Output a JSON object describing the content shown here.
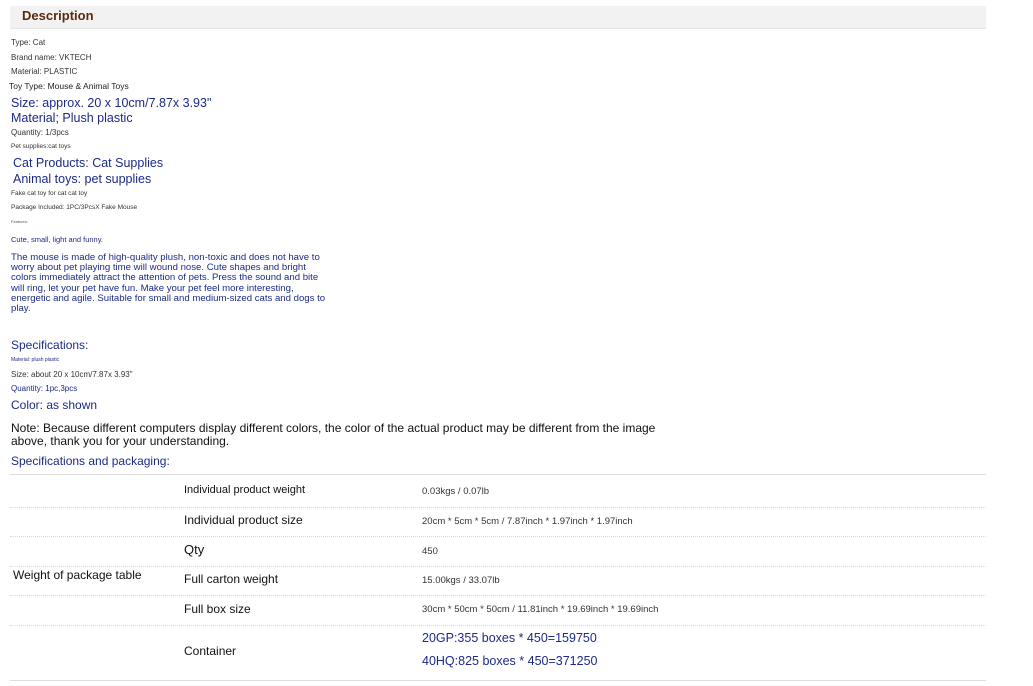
{
  "header": {
    "title": "Description"
  },
  "attributes": [
    "Type: Cat",
    "Brand name: VKTECH",
    "Material: PLASTIC",
    "Toy Type: Mouse & Animal Toys"
  ],
  "highlights": {
    "size": "Size: approx. 20 x 10cm/7.87x 3.93\"",
    "material": "Material; Plush plastic"
  },
  "quantity_line": "Quantity: 1/3pcs",
  "pet_supplies": "Pet supplies:cat toys",
  "cat_products": "Cat Products: Cat Supplies",
  "animal_toys": "Animal toys: pet supplies",
  "fake_toy": "Fake cat toy for cat cat toy",
  "package_included": "Package Included: 1PC/3PcsX Fake Mouse",
  "features_label": "Features:",
  "features_summary": "Cute, small, light and funny.",
  "features_paragraph": "The mouse is made of high-quality plush, non-toxic and does not have to worry about pet playing time will wound nose. Cute shapes and bright colors immediately attract the attention of pets. Press the sound and bite will ring, let your pet have fun. Make your pet feel more interesting, energetic and agile. Suitable for small and medium-sized cats and dogs to play.",
  "specifications": {
    "heading": "Specifications:",
    "material": "Material: plush plastic",
    "size": "Size: about 20 x 10cm/7.87x 3.93\"",
    "quantity": "Quantity: 1pc,3pcs",
    "color": "Color: as shown"
  },
  "note": "Note: Because different computers display different colors, the color of the actual product may be different from the image above, thank you for your understanding.",
  "packaging_heading": "Specifications and packaging:",
  "package_table": {
    "row_header": "Weight of package table",
    "rows": [
      {
        "label": "Individual product weight",
        "value": "0.03kgs / 0.07lb"
      },
      {
        "label": "Individual product size",
        "value": "20cm * 5cm * 5cm / 7.87inch * 1.97inch * 1.97inch"
      },
      {
        "label": "Qty",
        "value": "450"
      },
      {
        "label": "Full carton weight",
        "value": "15.00kgs / 33.07lb"
      },
      {
        "label": "Full box size",
        "value": "30cm * 50cm * 50cm / 11.81inch * 19.69inch * 19.69inch"
      }
    ],
    "container": {
      "label": "Container",
      "values": [
        "20GP:355 boxes * 450=159750",
        "40HQ:825 boxes * 450=371250"
      ]
    }
  }
}
